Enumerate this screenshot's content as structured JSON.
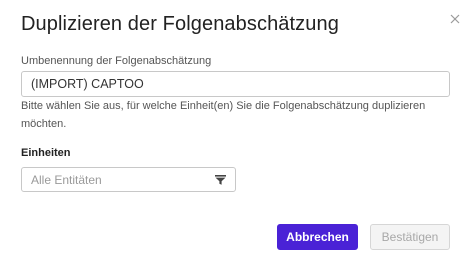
{
  "dialog": {
    "title": "Duplizieren der Folgenabschätzung",
    "close_icon": "close-icon"
  },
  "rename": {
    "label": "Umbenennung der Folgenabschätzung",
    "value": "(IMPORT) CAPTOO",
    "help_text": "Bitte wählen Sie aus, für welche Einheit(en) Sie die Folgenabschätzung duplizieren möchten."
  },
  "units": {
    "label": "Einheiten",
    "placeholder": "Alle Entitäten",
    "icon": "filter-icon"
  },
  "buttons": {
    "cancel": "Abbrechen",
    "confirm": "Bestätigen"
  },
  "colors": {
    "primary": "#4a22d6",
    "disabled_bg": "#f4f4f4",
    "disabled_text": "#a8a8a8",
    "border": "#c8c8c8"
  }
}
